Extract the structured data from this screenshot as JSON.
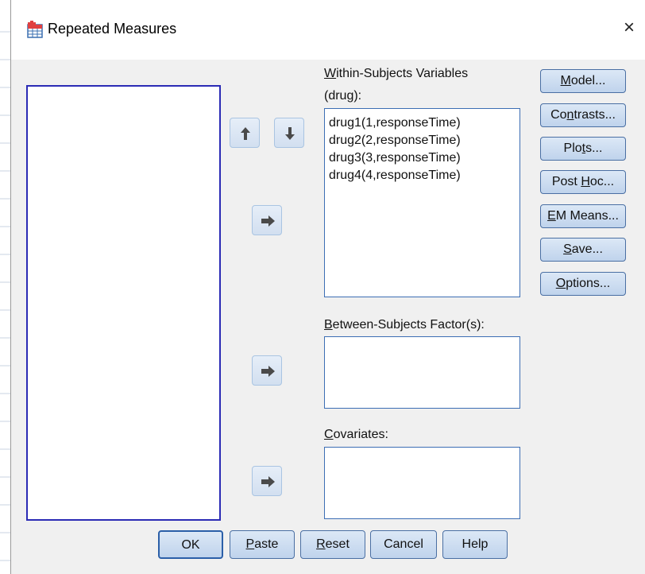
{
  "window": {
    "title": "Repeated Measures",
    "icon": "spss-grid-icon",
    "close_label": "×"
  },
  "within": {
    "label_first": "W",
    "label_rest": "ithin-Subjects Variables",
    "factor_label": "(drug):",
    "items": [
      "drug1(1,responseTime)",
      "drug2(2,responseTime)",
      "drug3(3,responseTime)",
      "drug4(4,responseTime)"
    ]
  },
  "between": {
    "label_first": "B",
    "label_rest": "etween-Subjects Factor(s):"
  },
  "covariates": {
    "label_first": "C",
    "label_rest": "ovariates:"
  },
  "side_buttons": {
    "model": {
      "pre": "",
      "u": "M",
      "post": "odel..."
    },
    "contrasts": {
      "pre": "Co",
      "u": "n",
      "post": "trasts..."
    },
    "plots": {
      "pre": "Plo",
      "u": "t",
      "post": "s..."
    },
    "posthoc": {
      "pre": "Post ",
      "u": "H",
      "post": "oc..."
    },
    "emmeans": {
      "pre": "",
      "u": "E",
      "post": "M Means..."
    },
    "save": {
      "pre": "",
      "u": "S",
      "post": "ave..."
    },
    "options": {
      "pre": "",
      "u": "O",
      "post": "ptions..."
    }
  },
  "bottom_buttons": {
    "ok": {
      "pre": "OK",
      "u": "",
      "post": ""
    },
    "paste": {
      "pre": "",
      "u": "P",
      "post": "aste"
    },
    "reset": {
      "pre": "",
      "u": "R",
      "post": "eset"
    },
    "cancel": {
      "pre": "Cancel",
      "u": "",
      "post": ""
    },
    "help": {
      "pre": "Help",
      "u": "",
      "post": ""
    }
  },
  "colors": {
    "list_border": "#2b2bb5",
    "button_border": "#4a6fa3",
    "button_fill": "#c9dbf0",
    "arrow_fill": "#4a4a4a"
  }
}
